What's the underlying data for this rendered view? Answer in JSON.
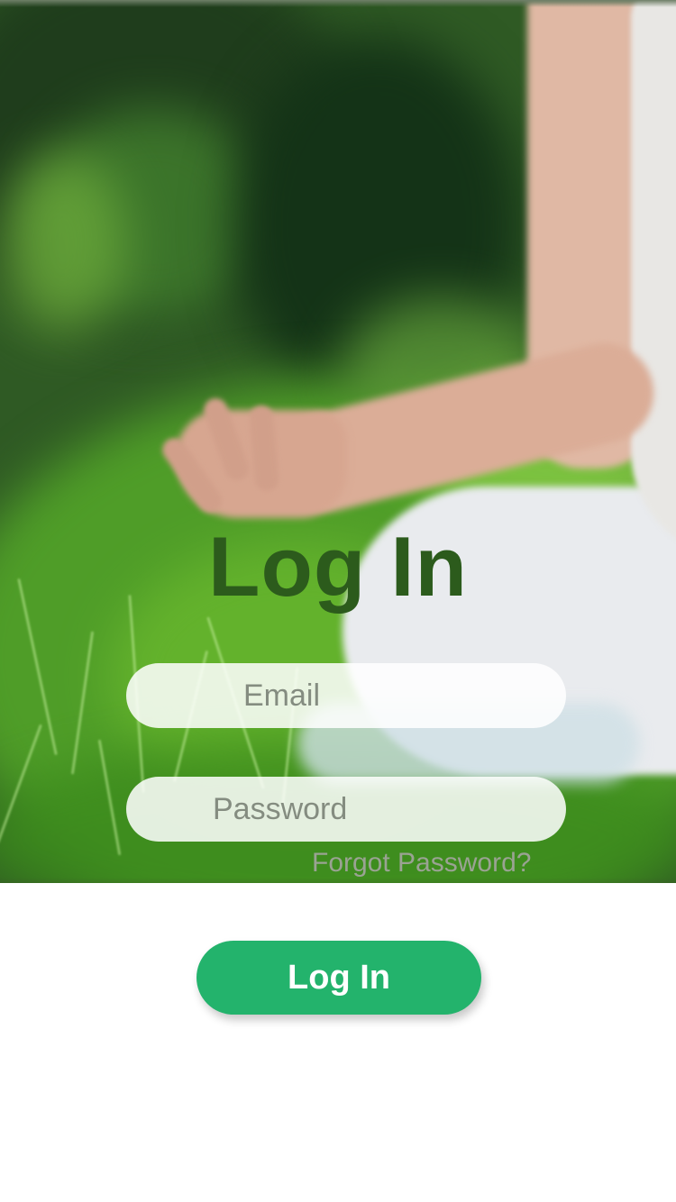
{
  "header": {
    "title": "Log In"
  },
  "form": {
    "email": {
      "placeholder": "Email",
      "value": ""
    },
    "password": {
      "placeholder": "Password",
      "value": ""
    },
    "forgot_password_label": "Forgot Password?",
    "submit_label": "Log In"
  },
  "background": {
    "icon": "yoga-meditation-photo"
  },
  "colors": {
    "title": "#2c5b1c",
    "accent": "#23b36c",
    "link": "#9aa393"
  }
}
